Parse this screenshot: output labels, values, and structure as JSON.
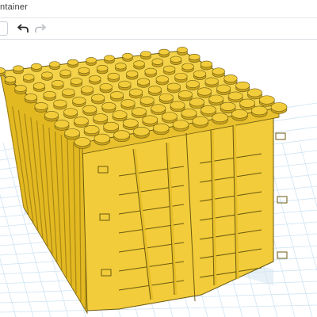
{
  "app": {
    "title": "ntainer"
  },
  "toolbar": {
    "undo_icon": "undo-icon",
    "redo_icon": "redo-icon",
    "undo_enabled": true,
    "redo_enabled": false
  },
  "scene": {
    "object": "shipping-container",
    "object_color": "#f2cc3a",
    "grid_color": "#cfe4f3",
    "background_color": "#ffffff"
  }
}
